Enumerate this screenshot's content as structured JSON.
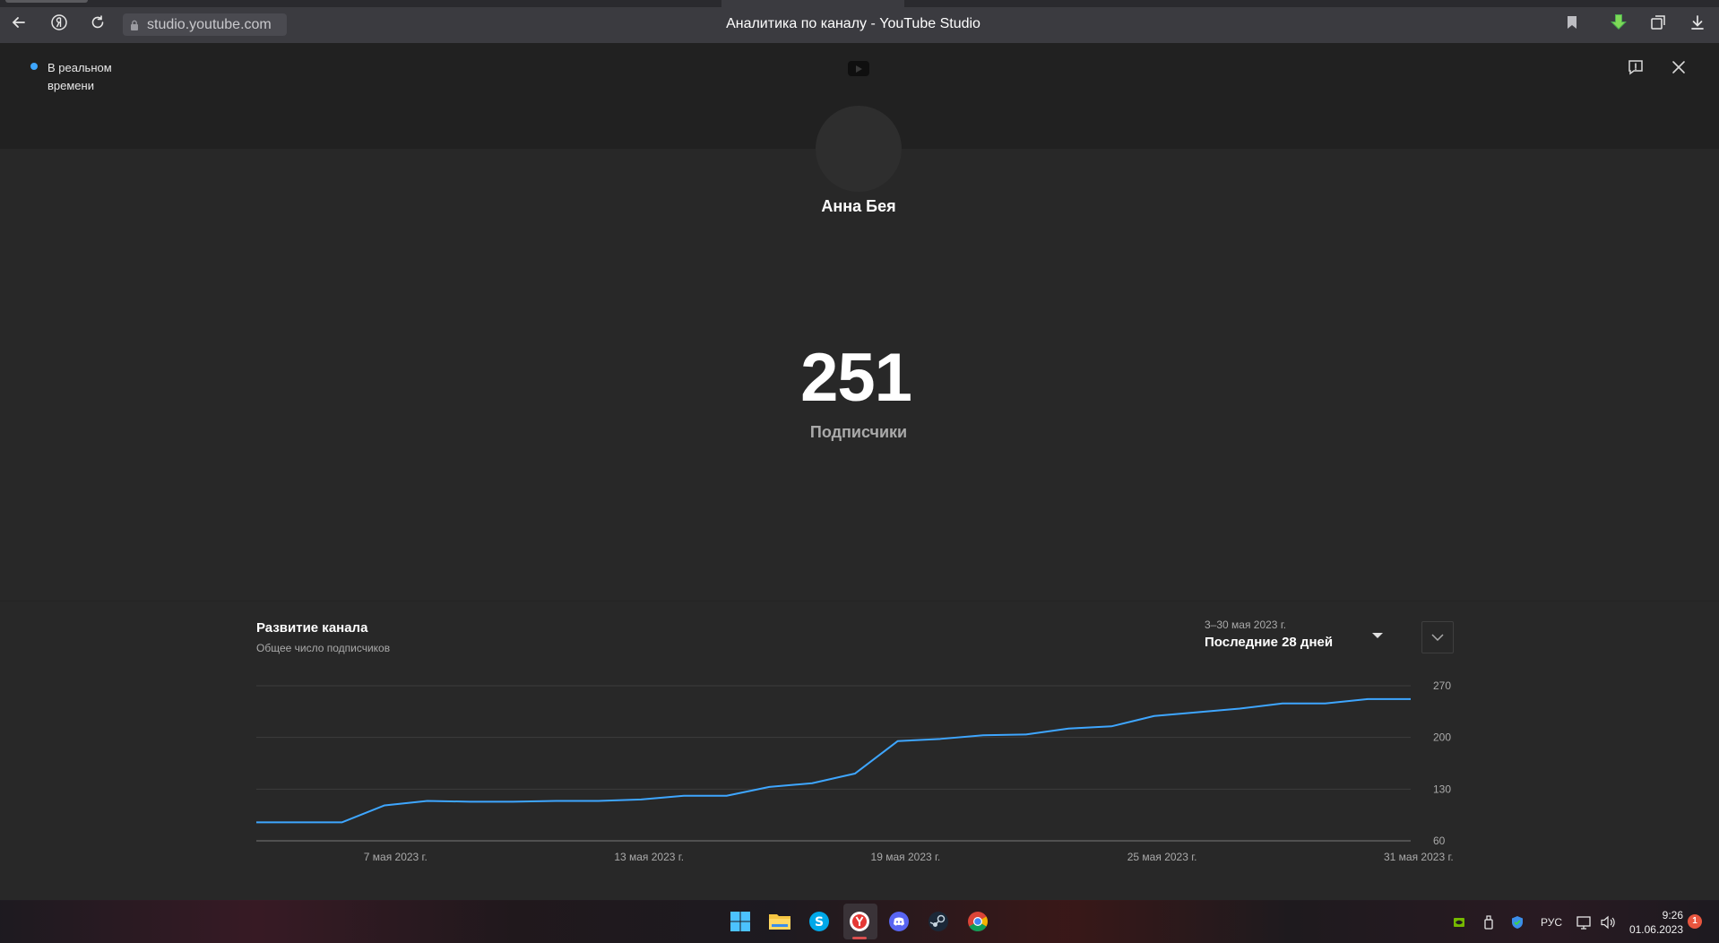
{
  "browser": {
    "url": "studio.youtube.com",
    "title": "Аналитика по каналу - YouTube Studio"
  },
  "header": {
    "realtime_label": "В реальном времени"
  },
  "channel": {
    "name": "Анна Бея",
    "subscriber_count": "251",
    "subscriber_label": "Подписчики"
  },
  "growth_card": {
    "title": "Развитие канала",
    "subtitle": "Общее число подписчиков",
    "range_dates": "3–30 мая 2023 г.",
    "range_label": "Последние 28 дней"
  },
  "chart_data": {
    "type": "line",
    "title": "Развитие канала",
    "subtitle": "Общее число подписчиков",
    "x": [
      "2023-05-03",
      "2023-05-04",
      "2023-05-05",
      "2023-05-06",
      "2023-05-07",
      "2023-05-08",
      "2023-05-09",
      "2023-05-10",
      "2023-05-11",
      "2023-05-12",
      "2023-05-13",
      "2023-05-14",
      "2023-05-15",
      "2023-05-16",
      "2023-05-17",
      "2023-05-18",
      "2023-05-19",
      "2023-05-20",
      "2023-05-21",
      "2023-05-22",
      "2023-05-23",
      "2023-05-24",
      "2023-05-25",
      "2023-05-26",
      "2023-05-27",
      "2023-05-28",
      "2023-05-29",
      "2023-05-30"
    ],
    "series": [
      {
        "values": [
          85,
          85,
          85,
          108,
          114,
          113,
          113,
          114,
          114,
          116,
          121,
          121,
          133,
          138,
          151,
          195,
          198,
          203,
          204,
          212,
          215,
          229,
          234,
          239,
          246,
          246,
          252,
          252
        ]
      }
    ],
    "ylim": [
      60,
      270
    ],
    "yticks": [
      "270",
      "200",
      "130",
      "60"
    ],
    "xtick_labels": [
      "7 мая 2023 г.",
      "13 мая 2023 г.",
      "19 мая 2023 г.",
      "25 мая 2023 г.",
      "31 мая 2023 г."
    ],
    "grid": true,
    "color": "#3ea6ff"
  },
  "taskbar": {
    "apps": [
      "windows-start",
      "file-explorer",
      "skype",
      "yandex-browser",
      "discord",
      "steam",
      "chrome"
    ],
    "language": "РУС",
    "time": "9:26",
    "date": "01.06.2023",
    "notifications": "1"
  }
}
